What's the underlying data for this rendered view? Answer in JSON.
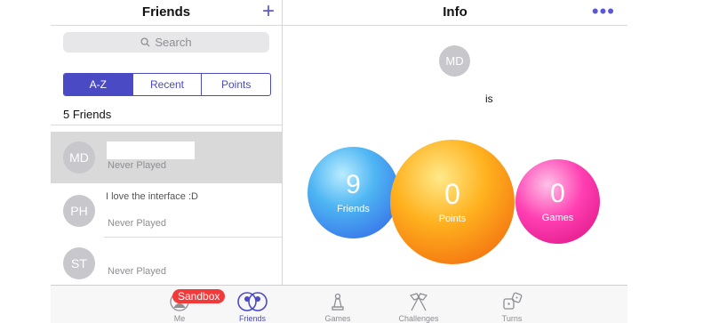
{
  "left_panel": {
    "title": "Friends",
    "add_icon": "plus-icon",
    "search_placeholder": "Search",
    "segments": [
      "A-Z",
      "Recent",
      "Points"
    ],
    "count": "5 Friends",
    "friends": [
      {
        "initials": "MD",
        "message": "",
        "status": "Never Played",
        "selected": true
      },
      {
        "initials": "PH",
        "message": "I love the interface :D",
        "status": "Never Played",
        "selected": false
      },
      {
        "initials": "ST",
        "message": "",
        "status": "Never Played",
        "selected": false
      }
    ]
  },
  "right_panel": {
    "title": "Info",
    "more_icon": "ellipsis-icon",
    "avatar_initials": "MD",
    "is_text": "is",
    "stats": {
      "friends": {
        "value": "9",
        "label": "Friends",
        "color": "#3a8ff0"
      },
      "points": {
        "value": "0",
        "label": "Points",
        "color": "#ff9a14"
      },
      "games": {
        "value": "0",
        "label": "Games",
        "color": "#ff2aa6"
      }
    }
  },
  "tabbar": {
    "badge": "Sandbox",
    "tabs": [
      {
        "label": "Me",
        "icon": "person-icon",
        "active": false
      },
      {
        "label": "Friends",
        "icon": "friends-icon",
        "active": true
      },
      {
        "label": "Games",
        "icon": "game-piece-icon",
        "active": false
      },
      {
        "label": "Challenges",
        "icon": "flags-icon",
        "active": false
      },
      {
        "label": "Turns",
        "icon": "dice-icon",
        "active": false
      }
    ]
  },
  "colors": {
    "accent": "#4a4ac4"
  }
}
